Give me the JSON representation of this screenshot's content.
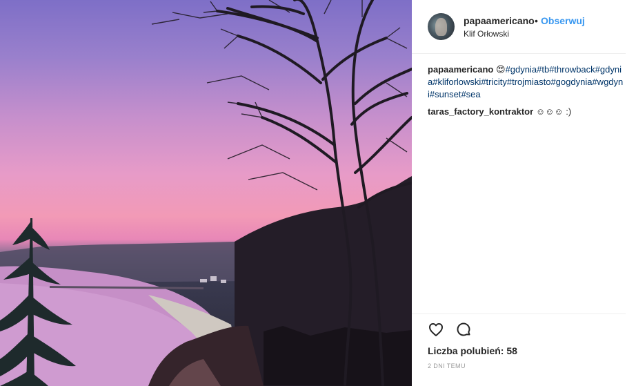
{
  "header": {
    "username": "papaamericano",
    "separator": "•",
    "follow_label": "Obserwuj",
    "location": "Klif Orłowski"
  },
  "comments": [
    {
      "user": "papaamericano",
      "emoji": "😍",
      "hashtags": [
        "#gdynia",
        "#tb",
        "#throwback",
        "#gdynia",
        "#kliforlowski",
        "#tricity",
        "#trojmiasto",
        "#gogdynia",
        "#wgdyni",
        "#sunset",
        "#sea"
      ]
    },
    {
      "user": "taras_factory_kontraktor",
      "text": "☺☺☺ :)"
    }
  ],
  "footer": {
    "likes": "Liczba polubień: 58",
    "time": "2 DNI TEMU"
  },
  "icons": [
    "heart-icon",
    "comment-icon"
  ]
}
